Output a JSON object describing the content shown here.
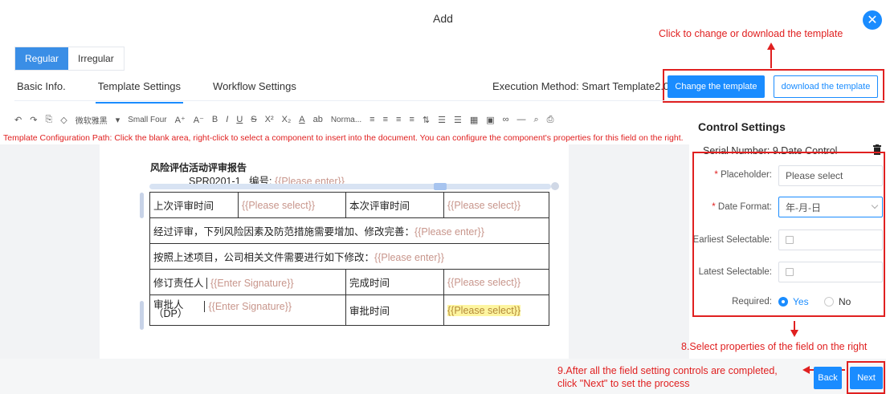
{
  "dialog": {
    "title": "Add",
    "close_glyph": "✕"
  },
  "annotations": {
    "change_template": "Click to change or download the template",
    "select_properties": "8.Select properties of the field on the right",
    "next_line1": "9.After all the field setting controls are completed,",
    "next_line2": "click \"Next\" to set the process"
  },
  "type_tabs": [
    {
      "label": "Regular",
      "active": true
    },
    {
      "label": "Irregular",
      "active": false
    }
  ],
  "main_tabs": [
    {
      "label": "Basic Info."
    },
    {
      "label": "Template Settings"
    },
    {
      "label": "Workflow Settings"
    }
  ],
  "execution_method": "Execution Method: Smart Template2.0",
  "buttons": {
    "change_template": "Change the template",
    "download_template": "download the template",
    "back": "Back",
    "next": "Next"
  },
  "toolbar": {
    "font_name": "微软雅黑",
    "font_size": "Small Four",
    "style": "Norma..."
  },
  "config_path": "Template Configuration Path: Click the blank area, right-click to select a component to insert into the document. You can configure the component's properties for this field on the right.",
  "document": {
    "title": "风险评估活动评审报告",
    "code": "SPR0201-1",
    "number_label": "编号:",
    "please_enter": "{{Please enter}}",
    "please_select": "{{Please select}}",
    "enter_signature": "{{Enter Signature}}",
    "last_review_time": "上次评审时间",
    "this_review_time": "本次评审时间",
    "row2_text": "经过评审，下列风险因素及防范措施需要增加、修改完善：",
    "row3_text": "按照上述项目，公司相关文件需要进行如下修改：",
    "revision_person": "修订责任人",
    "completion_time": "完成时间",
    "approver": "审批人（DP）",
    "approval_time": "审批时间"
  },
  "control_settings": {
    "title": "Control Settings",
    "serial": "Serial Number:  9.Date Control",
    "placeholder_label": "Placeholder:",
    "placeholder_value": "Please select",
    "date_format_label": "Date Format:",
    "date_format_value": "年-月-日",
    "earliest_label": "Earliest Selectable:",
    "latest_label": "Latest Selectable:",
    "required_label": "Required:",
    "yes": "Yes",
    "no": "No",
    "required_value": "Yes"
  },
  "colors": {
    "primary": "#1a8cff",
    "annotation": "#e02020"
  }
}
